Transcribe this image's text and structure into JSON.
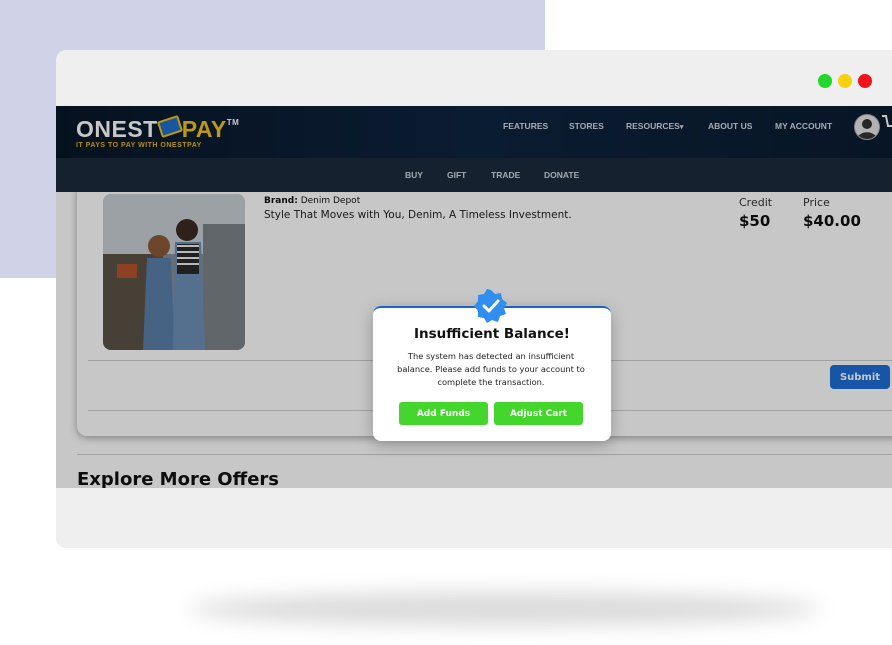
{
  "window": {
    "traffic_lights": [
      "#22d62a",
      "#f5d210",
      "#f0131b"
    ]
  },
  "logo": {
    "text_main": "ONEST",
    "text_pay": "PAY",
    "tm": "TM",
    "tagline": "IT PAYS TO PAY WITH ONESTPAY"
  },
  "nav": {
    "items": [
      "FEATURES",
      "STORES",
      "RESOURCES",
      "ABOUT US",
      "MY ACCOUNT"
    ],
    "resources_caret": "▾"
  },
  "subnav": {
    "items": [
      "BUY",
      "GIFT",
      "TRADE",
      "DONATE"
    ]
  },
  "product": {
    "brand_label": "Brand:",
    "brand_name": "Denim Depot",
    "description": "Style That Moves with You, Denim, A Timeless Investment.",
    "credit_label": "Credit",
    "credit_value": "$50",
    "price_label": "Price",
    "price_value": "$40.00",
    "submit_label": "Submit"
  },
  "section": {
    "explore_title": "Explore More Offers"
  },
  "modal": {
    "title": "Insufficient Balance!",
    "message": "The system has detected an insufficient balance. Please add funds to your account to complete the transaction.",
    "add_funds_label": "Add Funds",
    "adjust_cart_label": "Adjust Cart"
  },
  "colors": {
    "navbar": "#0b1e33",
    "subnav": "#1b2b3d",
    "accent_blue": "#1e6fd6",
    "button_green": "#44d62c",
    "logo_gold": "#f2c21b"
  }
}
